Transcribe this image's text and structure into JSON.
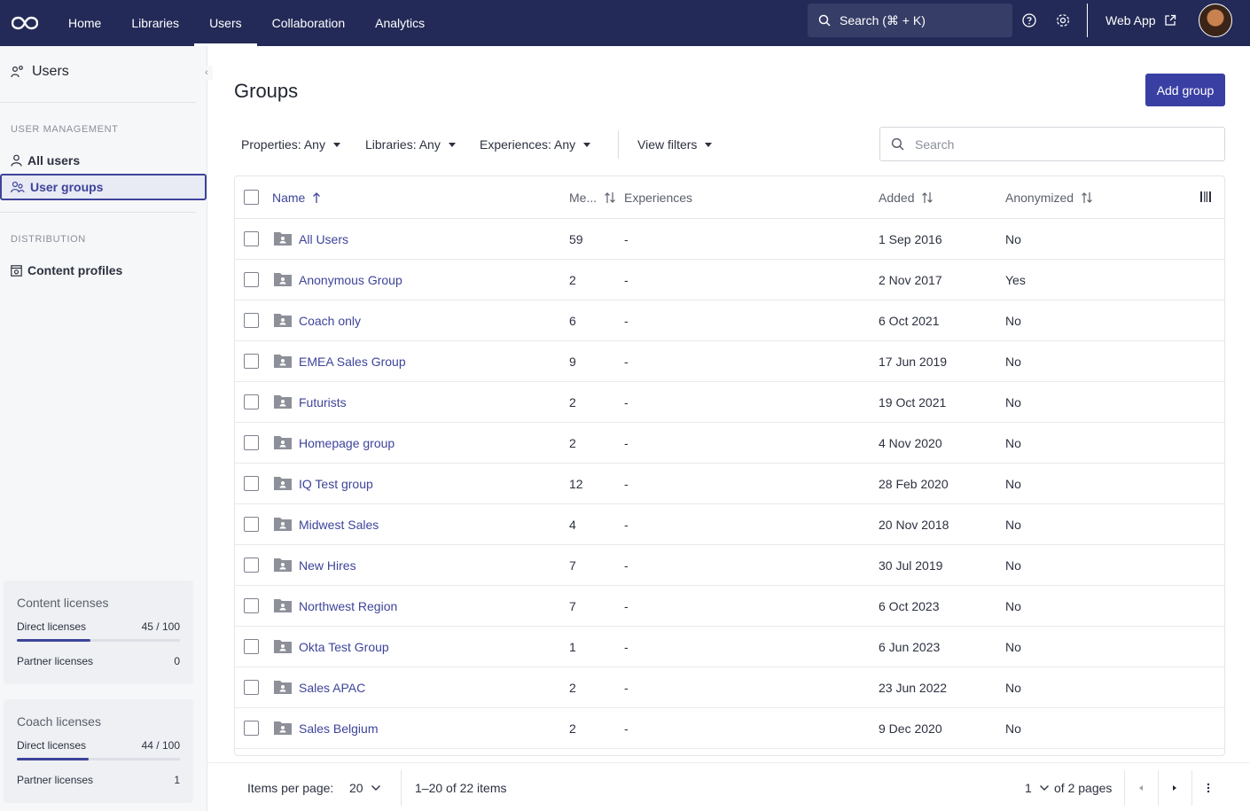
{
  "nav": {
    "items": [
      "Home",
      "Libraries",
      "Users",
      "Collaboration",
      "Analytics"
    ],
    "search_label": "Search (⌘ + K)",
    "webapp_label": "Web App"
  },
  "sidebar": {
    "title": "Users",
    "section1": "USER MANAGEMENT",
    "all_users": "All users",
    "user_groups": "User groups",
    "section2": "DISTRIBUTION",
    "content_profiles": "Content profiles",
    "content_licenses": {
      "title": "Content licenses",
      "direct_label": "Direct licenses",
      "direct_value": "45 / 100",
      "direct_fraction": 0.45,
      "partner_label": "Partner licenses",
      "partner_value": "0"
    },
    "coach_licenses": {
      "title": "Coach licenses",
      "direct_label": "Direct licenses",
      "direct_value": "44 / 100",
      "direct_fraction": 0.44,
      "partner_label": "Partner licenses",
      "partner_value": "1"
    }
  },
  "main": {
    "title": "Groups",
    "add_button": "Add group",
    "filters": {
      "properties": "Properties: Any",
      "libraries": "Libraries: Any",
      "experiences": "Experiences: Any",
      "view_filters": "View filters"
    },
    "search_placeholder": "Search",
    "columns": {
      "name": "Name",
      "members": "Me...",
      "experiences": "Experiences",
      "added": "Added",
      "anonymized": "Anonymized"
    },
    "rows": [
      {
        "name": "All Users",
        "members": "59",
        "experiences": "-",
        "added": "1 Sep 2016",
        "anonymized": "No"
      },
      {
        "name": "Anonymous Group",
        "members": "2",
        "experiences": "-",
        "added": "2 Nov 2017",
        "anonymized": "Yes"
      },
      {
        "name": "Coach only",
        "members": "6",
        "experiences": "-",
        "added": "6 Oct 2021",
        "anonymized": "No"
      },
      {
        "name": "EMEA Sales Group",
        "members": "9",
        "experiences": "-",
        "added": "17 Jun 2019",
        "anonymized": "No"
      },
      {
        "name": "Futurists",
        "members": "2",
        "experiences": "-",
        "added": "19 Oct 2021",
        "anonymized": "No"
      },
      {
        "name": "Homepage group",
        "members": "2",
        "experiences": "-",
        "added": "4 Nov 2020",
        "anonymized": "No"
      },
      {
        "name": "IQ Test group",
        "members": "12",
        "experiences": "-",
        "added": "28 Feb 2020",
        "anonymized": "No"
      },
      {
        "name": "Midwest Sales",
        "members": "4",
        "experiences": "-",
        "added": "20 Nov 2018",
        "anonymized": "No"
      },
      {
        "name": "New Hires",
        "members": "7",
        "experiences": "-",
        "added": "30 Jul 2019",
        "anonymized": "No"
      },
      {
        "name": "Northwest Region",
        "members": "7",
        "experiences": "-",
        "added": "6 Oct 2023",
        "anonymized": "No"
      },
      {
        "name": "Okta Test Group",
        "members": "1",
        "experiences": "-",
        "added": "6 Jun 2023",
        "anonymized": "No"
      },
      {
        "name": "Sales APAC",
        "members": "2",
        "experiences": "-",
        "added": "23 Jun 2022",
        "anonymized": "No"
      },
      {
        "name": "Sales Belgium",
        "members": "2",
        "experiences": "-",
        "added": "9 Dec 2020",
        "anonymized": "No"
      }
    ]
  },
  "footer": {
    "items_per_page_label": "Items per page:",
    "items_per_page_value": "20",
    "range_text": "1–20 of 22 items",
    "current_page": "1",
    "pages_text": "of 2 pages"
  },
  "colors": {
    "nav_bg": "#232a57",
    "accent": "#3a3fa3",
    "link": "#3d449a"
  }
}
